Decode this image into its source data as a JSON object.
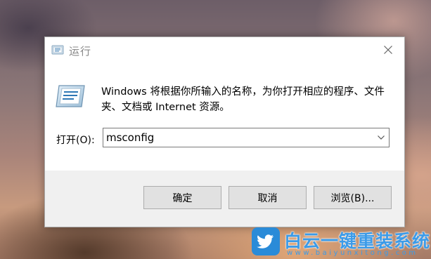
{
  "dialog": {
    "title": "运行",
    "description": "Windows 将根据你所输入的名称，为你打开相应的程序、文件夹、文档或 Internet 资源。",
    "open_label": "打开(O):",
    "input_value": "msconfig",
    "buttons": {
      "ok": "确定",
      "cancel": "取消",
      "browse": "浏览(B)..."
    }
  },
  "watermark": {
    "title": "白云一键重装系统",
    "url": "www.baiyunxitong.com"
  },
  "colors": {
    "watermark_blue": "#3c9be8",
    "dialog_bg": "#f0f0f0",
    "button_bg": "#e1e1e1"
  },
  "icons": [
    "run-app-icon",
    "close-icon",
    "chevron-down-icon",
    "twitter-bird-icon"
  ]
}
